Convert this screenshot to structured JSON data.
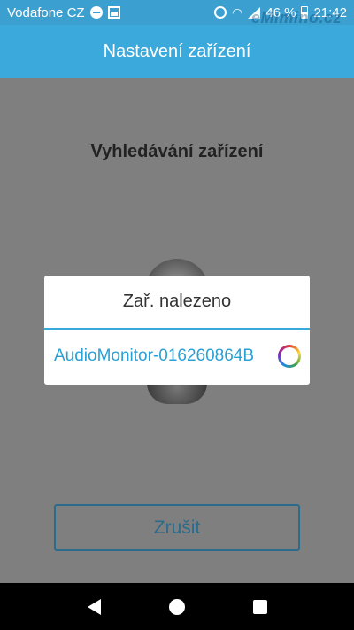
{
  "status_bar": {
    "carrier": "Vodafone CZ",
    "battery_percent": "46 %",
    "time": "21:42",
    "icons": [
      "do-not-disturb-icon",
      "gallery-icon",
      "alarm-icon",
      "wifi-icon",
      "signal-icon",
      "battery-icon"
    ]
  },
  "watermark": "eMimino.cz",
  "app_bar": {
    "title": "Nastavení zařízení"
  },
  "main": {
    "search_title": "Vyhledávání zařízení",
    "cancel_label": "Zrušit"
  },
  "dialog": {
    "title": "Zař. nalezeno",
    "items": [
      {
        "name": "AudioMonitor-016260864B",
        "icon": "loading-spinner-icon"
      }
    ]
  },
  "nav_bar": {
    "icons": [
      "back-icon",
      "home-icon",
      "recent-apps-icon"
    ]
  },
  "colors": {
    "accent": "#3ba9dc",
    "dialog_text": "#2aa0d4",
    "overlay": "#7f7f7f",
    "button_border": "#2b6b8c"
  }
}
